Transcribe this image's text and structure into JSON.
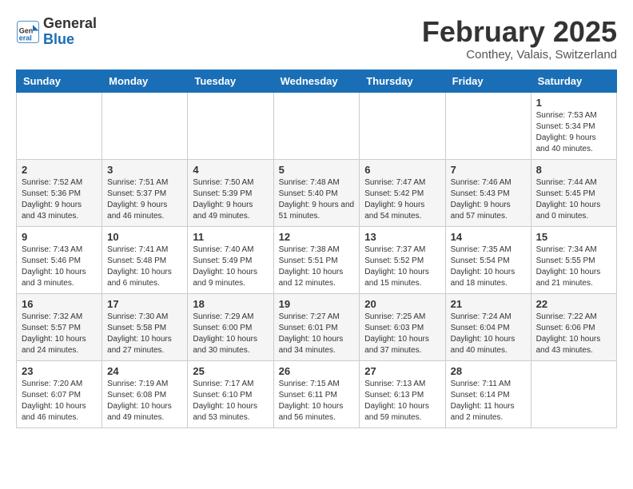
{
  "header": {
    "logo_line1": "General",
    "logo_line2": "Blue",
    "month": "February 2025",
    "location": "Conthey, Valais, Switzerland"
  },
  "days_of_week": [
    "Sunday",
    "Monday",
    "Tuesday",
    "Wednesday",
    "Thursday",
    "Friday",
    "Saturday"
  ],
  "weeks": [
    [
      {
        "day": "",
        "info": ""
      },
      {
        "day": "",
        "info": ""
      },
      {
        "day": "",
        "info": ""
      },
      {
        "day": "",
        "info": ""
      },
      {
        "day": "",
        "info": ""
      },
      {
        "day": "",
        "info": ""
      },
      {
        "day": "1",
        "info": "Sunrise: 7:53 AM\nSunset: 5:34 PM\nDaylight: 9 hours and 40 minutes."
      }
    ],
    [
      {
        "day": "2",
        "info": "Sunrise: 7:52 AM\nSunset: 5:36 PM\nDaylight: 9 hours and 43 minutes."
      },
      {
        "day": "3",
        "info": "Sunrise: 7:51 AM\nSunset: 5:37 PM\nDaylight: 9 hours and 46 minutes."
      },
      {
        "day": "4",
        "info": "Sunrise: 7:50 AM\nSunset: 5:39 PM\nDaylight: 9 hours and 49 minutes."
      },
      {
        "day": "5",
        "info": "Sunrise: 7:48 AM\nSunset: 5:40 PM\nDaylight: 9 hours and 51 minutes."
      },
      {
        "day": "6",
        "info": "Sunrise: 7:47 AM\nSunset: 5:42 PM\nDaylight: 9 hours and 54 minutes."
      },
      {
        "day": "7",
        "info": "Sunrise: 7:46 AM\nSunset: 5:43 PM\nDaylight: 9 hours and 57 minutes."
      },
      {
        "day": "8",
        "info": "Sunrise: 7:44 AM\nSunset: 5:45 PM\nDaylight: 10 hours and 0 minutes."
      }
    ],
    [
      {
        "day": "9",
        "info": "Sunrise: 7:43 AM\nSunset: 5:46 PM\nDaylight: 10 hours and 3 minutes."
      },
      {
        "day": "10",
        "info": "Sunrise: 7:41 AM\nSunset: 5:48 PM\nDaylight: 10 hours and 6 minutes."
      },
      {
        "day": "11",
        "info": "Sunrise: 7:40 AM\nSunset: 5:49 PM\nDaylight: 10 hours and 9 minutes."
      },
      {
        "day": "12",
        "info": "Sunrise: 7:38 AM\nSunset: 5:51 PM\nDaylight: 10 hours and 12 minutes."
      },
      {
        "day": "13",
        "info": "Sunrise: 7:37 AM\nSunset: 5:52 PM\nDaylight: 10 hours and 15 minutes."
      },
      {
        "day": "14",
        "info": "Sunrise: 7:35 AM\nSunset: 5:54 PM\nDaylight: 10 hours and 18 minutes."
      },
      {
        "day": "15",
        "info": "Sunrise: 7:34 AM\nSunset: 5:55 PM\nDaylight: 10 hours and 21 minutes."
      }
    ],
    [
      {
        "day": "16",
        "info": "Sunrise: 7:32 AM\nSunset: 5:57 PM\nDaylight: 10 hours and 24 minutes."
      },
      {
        "day": "17",
        "info": "Sunrise: 7:30 AM\nSunset: 5:58 PM\nDaylight: 10 hours and 27 minutes."
      },
      {
        "day": "18",
        "info": "Sunrise: 7:29 AM\nSunset: 6:00 PM\nDaylight: 10 hours and 30 minutes."
      },
      {
        "day": "19",
        "info": "Sunrise: 7:27 AM\nSunset: 6:01 PM\nDaylight: 10 hours and 34 minutes."
      },
      {
        "day": "20",
        "info": "Sunrise: 7:25 AM\nSunset: 6:03 PM\nDaylight: 10 hours and 37 minutes."
      },
      {
        "day": "21",
        "info": "Sunrise: 7:24 AM\nSunset: 6:04 PM\nDaylight: 10 hours and 40 minutes."
      },
      {
        "day": "22",
        "info": "Sunrise: 7:22 AM\nSunset: 6:06 PM\nDaylight: 10 hours and 43 minutes."
      }
    ],
    [
      {
        "day": "23",
        "info": "Sunrise: 7:20 AM\nSunset: 6:07 PM\nDaylight: 10 hours and 46 minutes."
      },
      {
        "day": "24",
        "info": "Sunrise: 7:19 AM\nSunset: 6:08 PM\nDaylight: 10 hours and 49 minutes."
      },
      {
        "day": "25",
        "info": "Sunrise: 7:17 AM\nSunset: 6:10 PM\nDaylight: 10 hours and 53 minutes."
      },
      {
        "day": "26",
        "info": "Sunrise: 7:15 AM\nSunset: 6:11 PM\nDaylight: 10 hours and 56 minutes."
      },
      {
        "day": "27",
        "info": "Sunrise: 7:13 AM\nSunset: 6:13 PM\nDaylight: 10 hours and 59 minutes."
      },
      {
        "day": "28",
        "info": "Sunrise: 7:11 AM\nSunset: 6:14 PM\nDaylight: 11 hours and 2 minutes."
      },
      {
        "day": "",
        "info": ""
      }
    ]
  ]
}
